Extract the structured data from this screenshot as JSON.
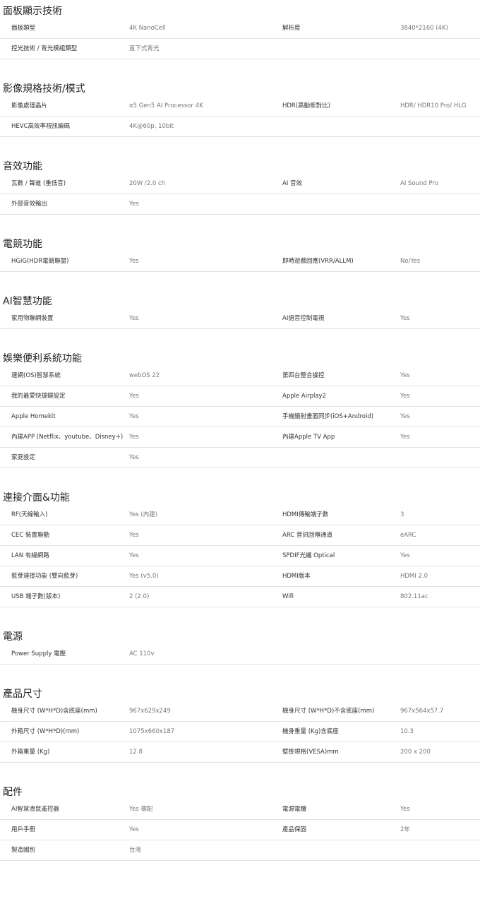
{
  "sections": [
    {
      "title": "面板顯示技術",
      "rows": [
        {
          "l1": "面板類型",
          "v1": "4K NanoCell",
          "l2": "解析度",
          "v2": "3840*2160 (4K)"
        },
        {
          "l1": "控光技術 / 背光模組類型",
          "v1": "直下式背光",
          "l2": "",
          "v2": ""
        }
      ]
    },
    {
      "title": "影像規格技術/模式",
      "rows": [
        {
          "l1": "影像處理晶片",
          "v1": "α5 Gen5 AI Processor 4K",
          "l2": "HDR(高動態對比)",
          "v2": "HDR/ HDR10 Pro/ HLG"
        },
        {
          "l1": "HEVC高效率視訊編碼",
          "v1": "4K@60p, 10bit",
          "l2": "",
          "v2": ""
        }
      ]
    },
    {
      "title": "音效功能",
      "rows": [
        {
          "l1": "瓦數 / 聲道 (重低音)",
          "v1": "20W /2.0 ch",
          "l2": "AI 音效",
          "v2": "AI Sound Pro"
        },
        {
          "l1": "外部音效輸出",
          "v1": "Yes",
          "l2": "",
          "v2": ""
        }
      ]
    },
    {
      "title": "電競功能",
      "rows": [
        {
          "l1": "HGiG(HDR電競聯盟)",
          "v1": "Yes",
          "l2": "即時遊戲回應(VRR/ALLM)",
          "v2": "No/Yes"
        }
      ]
    },
    {
      "title": "AI智慧功能",
      "rows": [
        {
          "l1": "家用物聯網裝置",
          "v1": "Yes",
          "l2": "AI語音控制電視",
          "v2": "Yes"
        }
      ]
    },
    {
      "title": "娛樂便利系統功能",
      "rows": [
        {
          "l1": "連網(OS)智慧系統",
          "v1": "webOS 22",
          "l2": "第四台整合操控",
          "v2": "Yes"
        },
        {
          "l1": "我的最愛快捷鍵設定",
          "v1": "Yes",
          "l2": "Apple Airplay2",
          "v2": "Yes"
        },
        {
          "l1": "Apple Homekit",
          "v1": "Yes",
          "l2": "手機鏡射畫面同步(iOS+Android)",
          "v2": "Yes"
        },
        {
          "l1": "內建APP (Netflix、youtube、Disney+)",
          "v1": "Yes",
          "l2": "內建Apple TV App",
          "v2": "Yes"
        },
        {
          "l1": "家庭設定",
          "v1": "Yes",
          "l2": "",
          "v2": ""
        }
      ]
    },
    {
      "title": "連接介面&功能",
      "rows": [
        {
          "l1": "RF(天線輸入)",
          "v1": "Yes (內建)",
          "l2": "HDMI傳輸端子數",
          "v2": "3"
        },
        {
          "l1": "CEC 裝置聯動",
          "v1": "Yes",
          "l2": "ARC 音訊回傳通道",
          "v2": "eARC"
        },
        {
          "l1": "LAN 有線網路",
          "v1": "Yes",
          "l2": "SPDIF光纖 Optical",
          "v2": "Yes"
        },
        {
          "l1": "藍芽連接功能 (雙向藍芽)",
          "v1": "Yes (v5.0)",
          "l2": "HDMI版本",
          "v2": "HDMI 2.0"
        },
        {
          "l1": "USB 端子數(版本)",
          "v1": "2 (2.0)",
          "l2": "Wifi",
          "v2": "802.11ac"
        }
      ]
    },
    {
      "title": "電源",
      "rows": [
        {
          "l1": "Power Supply 電壓",
          "v1": "AC 110v",
          "l2": "",
          "v2": ""
        }
      ]
    },
    {
      "title": "產品尺寸",
      "rows": [
        {
          "l1": "機身尺寸 (W*H*D)含底座(mm)",
          "v1": "967x629x249",
          "l2": "機身尺寸 (W*H*D)不含底座(mm)",
          "v2": "967x564x57.7"
        },
        {
          "l1": "外箱尺寸 (W*H*D)(mm)",
          "v1": "1075x660x187",
          "l2": "機身重量 (Kg)含底座",
          "v2": "10.3"
        },
        {
          "l1": "外箱重量 (Kg)",
          "v1": "12.8",
          "l2": "壁掛規格(VESA)mm",
          "v2": "200 x 200"
        }
      ]
    },
    {
      "title": "配件",
      "rows": [
        {
          "l1": "AI智慧滑鼠遙控器",
          "v1": "Yes 標配",
          "l2": "電源電纜",
          "v2": "Yes"
        },
        {
          "l1": "用戶手冊",
          "v1": "Yes",
          "l2": "產品保固",
          "v2": "2年"
        },
        {
          "l1": "製造國別",
          "v1": "台灣",
          "l2": "",
          "v2": ""
        }
      ]
    }
  ]
}
